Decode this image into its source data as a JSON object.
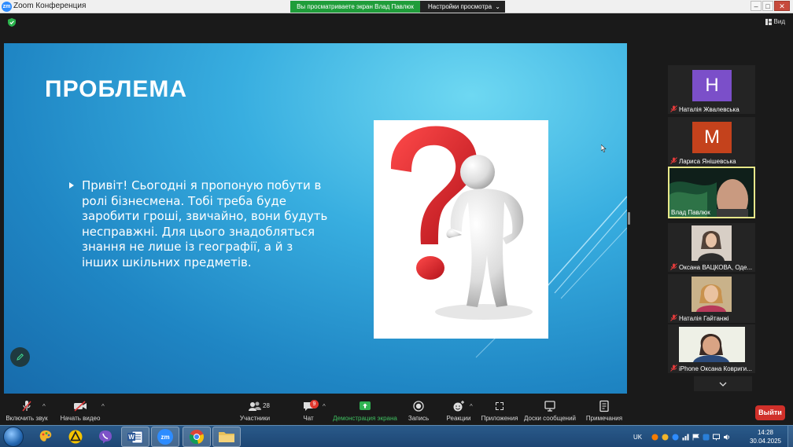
{
  "window": {
    "app_logo": "zm",
    "title": "Zoom Конференция",
    "share_banner": "Вы просматриваете экран Влад Павлюк",
    "view_options": "Настройки просмотра"
  },
  "topbar": {
    "view_label": "Вид"
  },
  "slide": {
    "title": "ПРОБЛЕМА",
    "bullet": "Привіт! Сьогодні я пропоную побути в ролі бізнесмена. Тобі треба буде заробити гроші, звичайно, вони будуть несправжні. Для цього знадобляться  знання не лише із географії, а й з інших шкільних предметів."
  },
  "participants": [
    {
      "name": "Наталія Жвалевська",
      "avatar_letter": "Н",
      "avatar_color": "#7b4fc9",
      "muted": true
    },
    {
      "name": "Лариса Янішевська",
      "avatar_letter": "М",
      "avatar_color": "#c4421c",
      "muted": true
    },
    {
      "name": "Влад Павлюк",
      "active_speaker": true,
      "muted": false
    },
    {
      "name": "Оксана  ВАЦКОВА, Оде...",
      "muted": true
    },
    {
      "name": "Наталія Гайтанжі",
      "muted": true
    },
    {
      "name": "iPhone Оксана Ковриги...",
      "muted": true
    }
  ],
  "toolbar": {
    "unmute": "Включить звук",
    "start_video": "Начать видео",
    "participants": "Участники",
    "participants_count": "28",
    "chat": "Чат",
    "chat_badge": "9",
    "share_screen": "Демонстрация экрана",
    "record": "Запись",
    "reactions": "Реакции",
    "apps": "Приложения",
    "whiteboards": "Доски сообщений",
    "notes": "Примечания",
    "leave": "Выйти"
  },
  "taskbar": {
    "language": "UK",
    "time": "14:28",
    "date": "30.04.2025",
    "zoom_label": "zm"
  },
  "colors": {
    "share_green": "#1f9d3a",
    "leave_red": "#d0302a",
    "active_border": "#e8e88a",
    "slide_blue": "#1f86c4"
  }
}
